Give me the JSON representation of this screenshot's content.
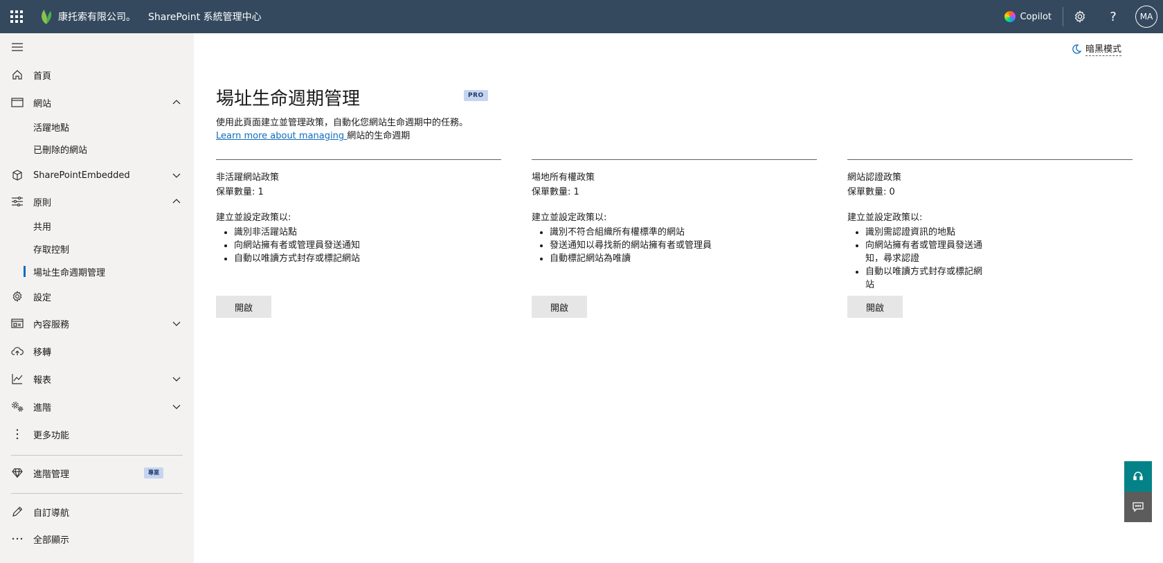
{
  "topbar": {
    "org_name": "康托索有限公司。",
    "app_name": "SharePoint 系統管理中心",
    "copilot_label": "Copilot",
    "help_glyph": "?",
    "avatar_initials": "MA",
    "icons": [
      "waffle-icon",
      "leaf-logo-icon",
      "copilot-icon",
      "gear-icon",
      "help-icon"
    ]
  },
  "sidebar": {
    "items": [
      {
        "label": "首頁",
        "icon": "home-icon"
      },
      {
        "label": "網站",
        "icon": "browser-window-icon",
        "expanded": true
      },
      {
        "label": "活躍地點",
        "sub": true
      },
      {
        "label": "已刪除的網站",
        "sub": true
      },
      {
        "label": "SharePointEmbedded",
        "icon": "cube-icon",
        "expanded": false
      },
      {
        "label": "原則",
        "icon": "sliders-icon",
        "expanded": true
      },
      {
        "label": "共用",
        "sub": true
      },
      {
        "label": "存取控制",
        "sub": true
      },
      {
        "label": "場址生命週期管理",
        "sub": true,
        "active": true
      },
      {
        "label": "設定",
        "icon": "gear-icon"
      },
      {
        "label": "內容服務",
        "icon": "content-icon",
        "expanded": false
      },
      {
        "label": "移轉",
        "icon": "cloud-upload-icon"
      },
      {
        "label": "報表",
        "icon": "line-chart-icon",
        "expanded": false
      },
      {
        "label": "進階",
        "icon": "gears-icon",
        "expanded": false
      },
      {
        "label": "更多功能",
        "icon": "more-vertical-icon"
      },
      {
        "label": "進階管理",
        "icon": "diamond-icon",
        "badge": "專業"
      },
      {
        "label": "自訂導航",
        "icon": "pencil-icon"
      },
      {
        "label": "全部顯示",
        "icon": "more-horizontal-icon"
      }
    ]
  },
  "main": {
    "dark_mode_label": "暗黑模式",
    "title": "場址生命週期管理",
    "pro_tag": "PRO",
    "description": "使用此頁面建立並管理政策，自動化您網站生命週期中的任務。",
    "learn_more_link": "Learn more about managing ",
    "learn_more_suffix": "網站的生命週期",
    "cards": [
      {
        "title": "非活躍網站政策",
        "count": "保單數量: 1",
        "intro": "建立並設定政策以:",
        "bullets": [
          "識別非活躍站點",
          "向網站擁有者或管理員發送通知",
          "自動以唯讀方式封存或標記網站"
        ],
        "button": "開啟"
      },
      {
        "title": "場地所有權政策",
        "count": "保單數量: 1",
        "intro": "建立並設定政策以:",
        "bullets": [
          "識別不符合組織所有權標準的網站",
          "發送通知以尋找新的網站擁有者或管理員",
          "自動標記網站為唯讀"
        ],
        "button": "開啟"
      },
      {
        "title": "網站認證政策",
        "count": "保單數量: 0",
        "intro": "建立並設定政策以:",
        "bullets": [
          "識別需認證資訊的地點",
          "向網站擁有者或管理員發送通知，尋求認證",
          "自動以唯讀方式封存或標記網站"
        ],
        "button": "開啟"
      }
    ]
  },
  "floating": {
    "help_icon": "headset-icon",
    "feedback_icon": "chat-feedback-icon"
  },
  "colors": {
    "topbar_bg": "#34495e",
    "sidebar_bg": "#f3f2f1",
    "accent": "#0f6cbd",
    "help_button_bg": "#038387",
    "feedback_button_bg": "#5c5c5c"
  }
}
